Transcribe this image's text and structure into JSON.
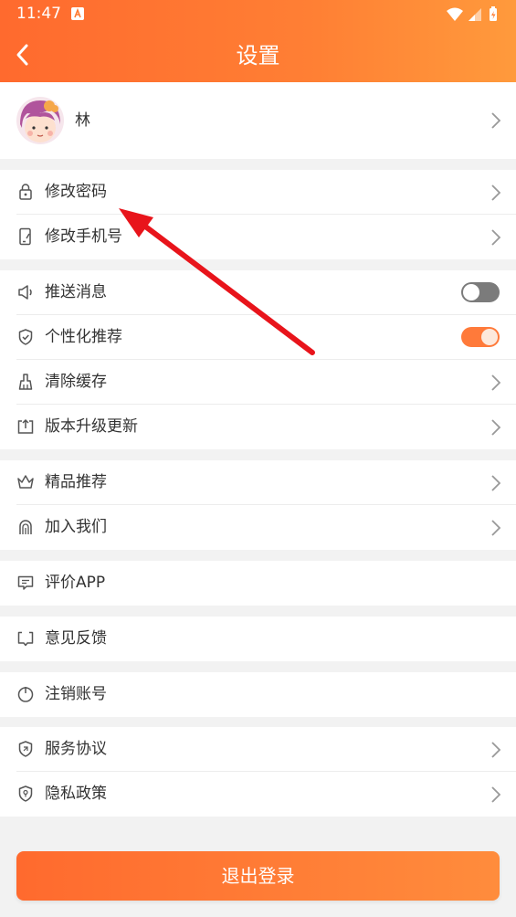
{
  "status_bar": {
    "time": "11:47"
  },
  "nav": {
    "title": "设置"
  },
  "profile": {
    "name": "林"
  },
  "account_items": [
    {
      "label": "修改密码",
      "icon": "lock-icon"
    },
    {
      "label": "修改手机号",
      "icon": "phone-edit-icon"
    }
  ],
  "settings_items": [
    {
      "label": "推送消息",
      "icon": "speaker-icon",
      "toggle": "off"
    },
    {
      "label": "个性化推荐",
      "icon": "shield-check-icon",
      "toggle": "on"
    },
    {
      "label": "清除缓存",
      "icon": "broom-icon"
    },
    {
      "label": "版本升级更新",
      "icon": "upload-box-icon"
    }
  ],
  "extra_items": [
    {
      "label": "精品推荐",
      "icon": "crown-icon"
    },
    {
      "label": "加入我们",
      "icon": "fingerprint-icon"
    }
  ],
  "rate_item": {
    "label": "评价APP",
    "icon": "comment-icon"
  },
  "feedback_item": {
    "label": "意见反馈",
    "icon": "feedback-icon"
  },
  "deregister_item": {
    "label": "注销账号",
    "icon": "power-icon"
  },
  "legal_items": [
    {
      "label": "服务协议",
      "icon": "service-shield-icon"
    },
    {
      "label": "隐私政策",
      "icon": "privacy-shield-icon"
    }
  ],
  "logout_label": "退出登录",
  "colors": {
    "accent": "#ff7a3a",
    "header_start": "#ff6a2e",
    "header_end": "#ff9a3c",
    "annotation_arrow": "#e8141b"
  }
}
